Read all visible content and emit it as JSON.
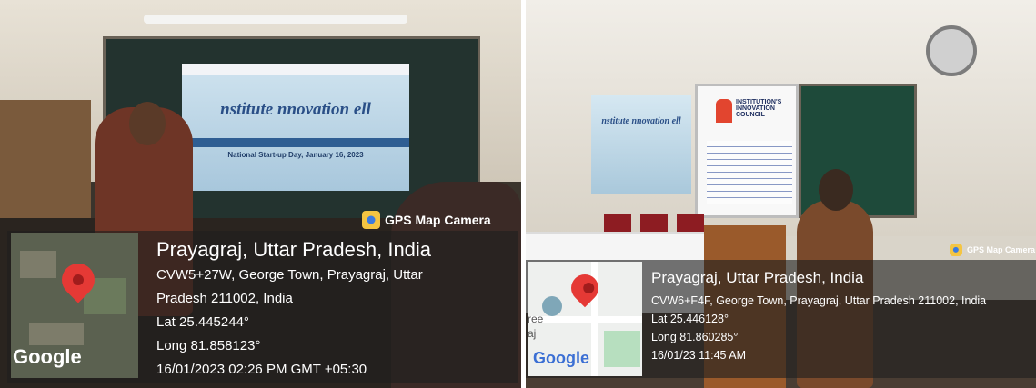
{
  "left_photo": {
    "slide": {
      "title": "nstitute   nnovation  ell",
      "subtitle": "National Start-up Day, January 16, 2023"
    },
    "badge": "GPS Map Camera",
    "location_title": "Prayagraj, Uttar Pradesh, India",
    "address_line1": "CVW5+27W, George Town, Prayagraj, Uttar",
    "address_line2": "Pradesh 211002, India",
    "lat": "Lat 25.445244°",
    "long": "Long 81.858123°",
    "datetime": "16/01/2023 02:26 PM GMT +05:30",
    "map_brand": "Google"
  },
  "right_photo": {
    "banner": {
      "title": "nstitute   nnovation  ell"
    },
    "screen": {
      "title": "INSTITUTION'S INNOVATION COUNCIL"
    },
    "badge": "GPS Map Camera",
    "location_title": "Prayagraj, Uttar Pradesh, India",
    "address_line1": "CVW6+F4F, George Town, Prayagraj, Uttar Pradesh 211002, India",
    "lat": "Lat 25.446128°",
    "long": "Long 81.860285°",
    "datetime": "16/01/23 11:45 AM",
    "map_brand": "Google",
    "map_fragment_1": "ree",
    "map_fragment_2": "aj"
  }
}
